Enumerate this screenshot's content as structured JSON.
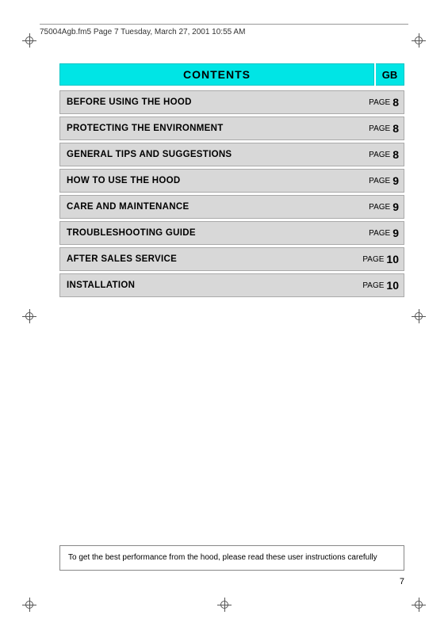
{
  "header": {
    "file_info": "75004Agb.fm5  Page 7  Tuesday, March 27, 2001  10:55 AM"
  },
  "title": {
    "main_label": "CONTENTS",
    "gb_label": "GB"
  },
  "toc": {
    "rows": [
      {
        "label": "BEFORE USING THE HOOD",
        "page_word": "PAGE",
        "page_num": "8"
      },
      {
        "label": "PROTECTING THE ENVIRONMENT",
        "page_word": "PAGE",
        "page_num": "8"
      },
      {
        "label": "GENERAL TIPS AND SUGGESTIONS",
        "page_word": "PAGE",
        "page_num": "8"
      },
      {
        "label": "HOW TO USE THE HOOD",
        "page_word": "PAGE",
        "page_num": "9"
      },
      {
        "label": "CARE AND MAINTENANCE",
        "page_word": "PAGE",
        "page_num": "9"
      },
      {
        "label": "TROUBLESHOOTING GUIDE",
        "page_word": "PAGE",
        "page_num": "9"
      },
      {
        "label": "AFTER SALES SERVICE",
        "page_word": "PAGE",
        "page_num": "10"
      },
      {
        "label": "INSTALLATION",
        "page_word": "PAGE",
        "page_num": "10"
      }
    ]
  },
  "footer": {
    "note": "To get the best performance from the hood, please read these user instructions carefully"
  },
  "page_number": "7"
}
